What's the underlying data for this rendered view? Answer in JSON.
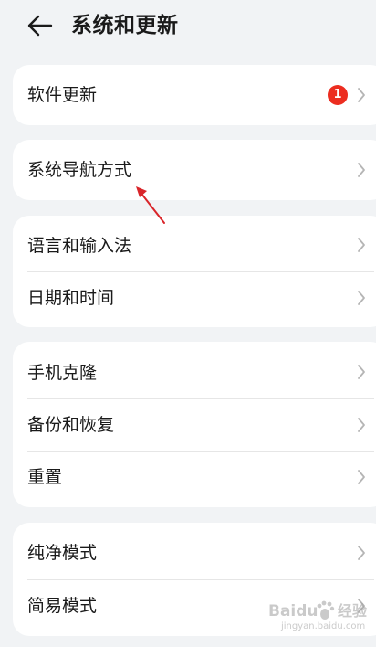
{
  "header": {
    "back_icon": "arrow-left-icon",
    "title": "系统和更新"
  },
  "groups": [
    {
      "items": [
        {
          "label": "软件更新",
          "badge": "1"
        }
      ]
    },
    {
      "items": [
        {
          "label": "系统导航方式"
        }
      ]
    },
    {
      "items": [
        {
          "label": "语言和输入法"
        },
        {
          "label": "日期和时间"
        }
      ]
    },
    {
      "items": [
        {
          "label": "手机克隆"
        },
        {
          "label": "备份和恢复"
        },
        {
          "label": "重置"
        }
      ]
    },
    {
      "items": [
        {
          "label": "纯净模式"
        },
        {
          "label": "简易模式"
        }
      ]
    }
  ],
  "colors": {
    "background": "#f1f3f5",
    "card": "#ffffff",
    "badge": "#ec2d20",
    "annotation_arrow": "#d9252a",
    "chevron": "#b5b5b5"
  },
  "watermark": {
    "text": "Baidu 经验",
    "subtext": "jingyan.baidu.com"
  }
}
